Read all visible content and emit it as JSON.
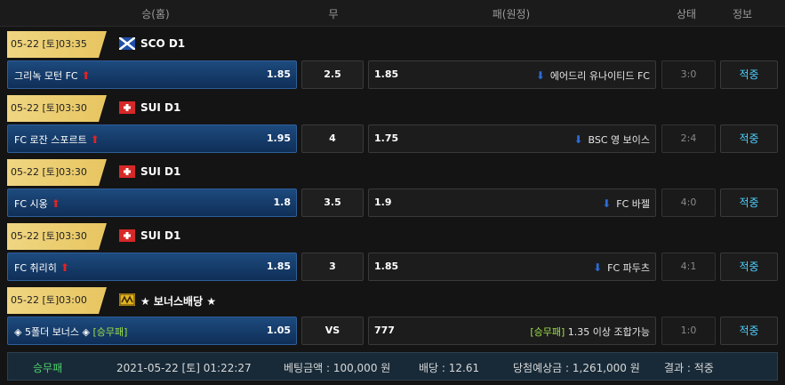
{
  "header": {
    "home": "승(홈)",
    "draw": "무",
    "away": "패(원정)",
    "status": "상태",
    "info": "정보"
  },
  "games": [
    {
      "league": {
        "date": "05-22 [토]03:35",
        "flag": "scotland-flag",
        "name": "SCO D1"
      },
      "home": {
        "name": "그리녹 모턴 FC",
        "odds": "1.85"
      },
      "draw": "2.5",
      "away": {
        "odds": "1.85",
        "name": "에어드리 유나이티드 FC"
      },
      "status": "3:0",
      "info": "적중"
    },
    {
      "league": {
        "date": "05-22 [토]03:30",
        "flag": "switzerland-flag",
        "name": "SUI D1"
      },
      "home": {
        "name": "FC 로잔 스포르트",
        "odds": "1.95"
      },
      "draw": "4",
      "away": {
        "odds": "1.75",
        "name": "BSC 영 보이스"
      },
      "status": "2:4",
      "info": "적중"
    },
    {
      "league": {
        "date": "05-22 [토]03:30",
        "flag": "switzerland-flag",
        "name": "SUI D1"
      },
      "home": {
        "name": "FC 시옹",
        "odds": "1.8"
      },
      "draw": "3.5",
      "away": {
        "odds": "1.9",
        "name": "FC 바젤"
      },
      "status": "4:0",
      "info": "적중"
    },
    {
      "league": {
        "date": "05-22 [토]03:30",
        "flag": "switzerland-flag",
        "name": "SUI D1"
      },
      "home": {
        "name": "FC 취리히",
        "odds": "1.85"
      },
      "draw": "3",
      "away": {
        "odds": "1.85",
        "name": "FC 파두츠"
      },
      "status": "4:1",
      "info": "적중"
    }
  ],
  "bonus": {
    "league": {
      "date": "05-22 [토]03:00",
      "flag": "bonus-icon",
      "name": "★ 보너스배당 ★"
    },
    "home": {
      "prefix": "◈ 5폴더 보너스 ◈",
      "tag": "[승무패]",
      "odds": "1.05"
    },
    "draw": "VS",
    "away": {
      "odds": "777",
      "tag": "[승무패]",
      "desc": "1.35 이상 조합가능"
    },
    "status": "1:0",
    "info": "적중"
  },
  "summary": {
    "type": "승무패",
    "datetime": "2021-05-22 [토] 01:22:27",
    "bet_amount": "베팅금액 : 100,000 원",
    "odds": "배당 : 12.61",
    "expected": "당첨예상금 : 1,261,000 원",
    "result": "결과 : 적중"
  }
}
